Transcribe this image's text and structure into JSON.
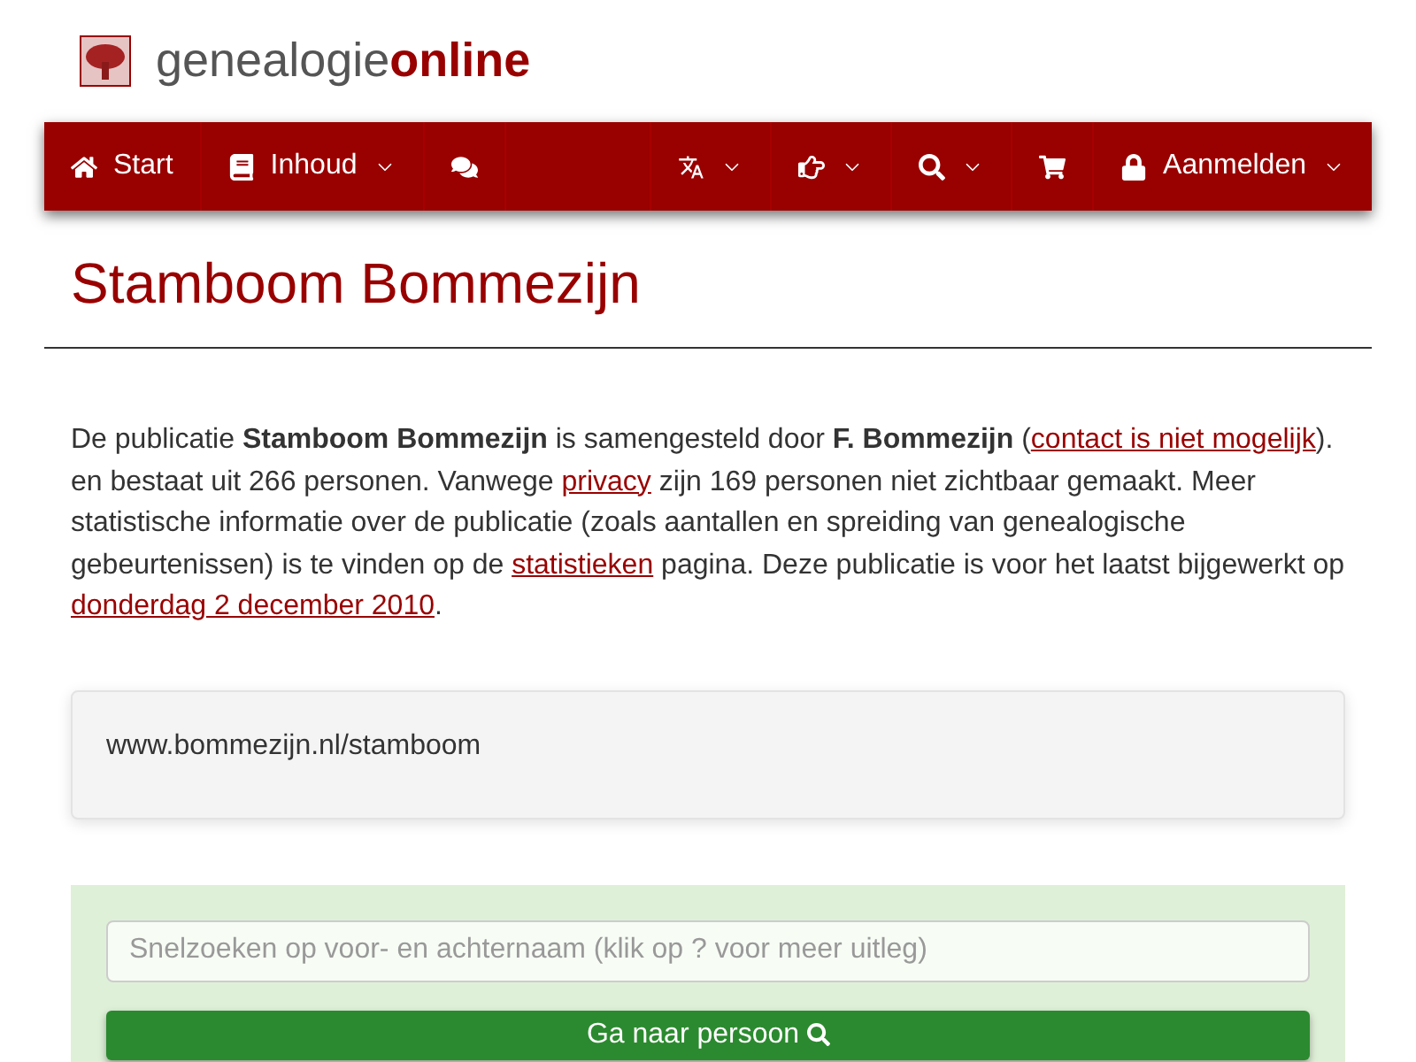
{
  "logo": {
    "prefix": "genealogie",
    "suffix": "online"
  },
  "nav": {
    "left": [
      {
        "label": "Start",
        "dropdown": false
      },
      {
        "label": "Inhoud",
        "dropdown": true
      },
      {
        "dropdown": false
      }
    ],
    "right": [
      {
        "dropdown": true
      },
      {
        "dropdown": true
      },
      {
        "dropdown": true
      },
      {
        "dropdown": false
      },
      {
        "label": "Aanmelden",
        "dropdown": true
      }
    ]
  },
  "title": "Stamboom Bommezijn",
  "intro": [
    {
      "kind": "text",
      "text": "De publicatie **Stamboom Bommezijn** is samengesteld door **F. Bommezijn** ("
    },
    {
      "kind": "link",
      "text": "contact is niet mogelijk"
    },
    {
      "kind": "text",
      "text": "). en bestaat uit 266 personen. Vanwege "
    },
    {
      "kind": "link",
      "text": "privacy"
    },
    {
      "kind": "text",
      "text": " zijn 169 personen niet zichtbaar gemaakt. Meer statistische informatie over de publicatie (zoals aantallen en spreiding van genealogische gebeurtenissen) is te vinden op de "
    },
    {
      "kind": "link",
      "text": "statistieken"
    },
    {
      "kind": "text",
      "text": " pagina. Deze publicatie is voor het laatst bijgewerkt op "
    },
    {
      "kind": "link",
      "text": "donderdag 2 december 2010"
    },
    {
      "kind": "text",
      "text": "."
    }
  ],
  "source_url": "www.bommezijn.nl/stamboom",
  "search": {
    "placeholder": "Snelzoeken op voor- en achternaam (klik op ? voor meer uitleg)",
    "button": "Ga naar persoon"
  }
}
